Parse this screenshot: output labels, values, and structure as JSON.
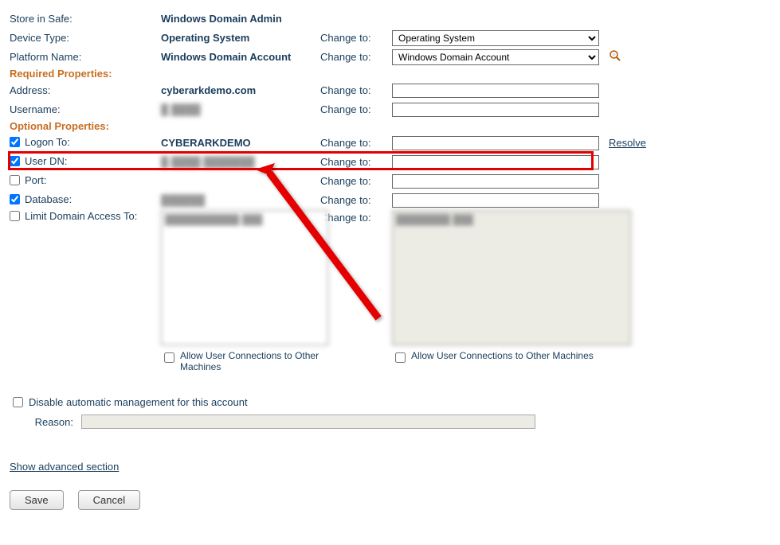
{
  "labels": {
    "store_in_safe": "Store in Safe:",
    "device_type": "Device Type:",
    "platform_name": "Platform Name:",
    "required_properties": "Required Properties:",
    "address": "Address:",
    "username": "Username:",
    "optional_properties": "Optional Properties:",
    "logon_to": "Logon To:",
    "user_dn": "User DN:",
    "port": "Port:",
    "database": "Database:",
    "limit_domain": "Limit Domain Access To:",
    "change_to": "Change to:",
    "resolve": "Resolve",
    "allow_connections": "Allow User Connections to Other Machines",
    "disable_auto": "Disable automatic management for this account",
    "reason": "Reason:",
    "advanced": "Show advanced section",
    "save": "Save",
    "cancel": "Cancel"
  },
  "values": {
    "safe": "Windows Domain Admin",
    "device_type": "Operating System",
    "platform_name": "Windows Domain Account",
    "address": "cyberarkdemo.com",
    "username": "█ ████",
    "logon_to": "CYBERARKDEMO",
    "user_dn": "█ ████ ███████",
    "database": "██████",
    "limit_left": "███████████\n███",
    "limit_right": "████████\n███"
  },
  "selects": {
    "device_type": "Operating System",
    "platform_name": "Windows Domain Account"
  },
  "checkboxes": {
    "logon_to": true,
    "user_dn": true,
    "port": false,
    "database": true,
    "limit_domain": false,
    "allow_left": false,
    "allow_right": false,
    "disable_auto": false
  }
}
